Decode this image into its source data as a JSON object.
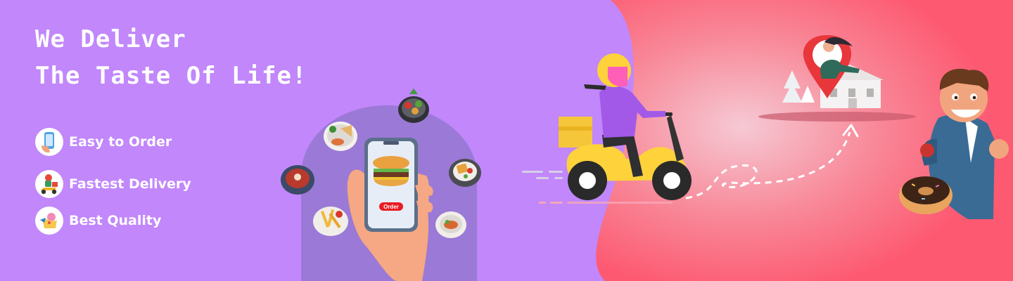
{
  "headline": {
    "line1": "We Deliver",
    "line2": "The Taste Of Life!"
  },
  "features": [
    {
      "label": "Easy to Order",
      "icon": "phone-order-icon"
    },
    {
      "label": "Fastest Delivery",
      "icon": "delivery-scooter-icon"
    },
    {
      "label": "Best Quality",
      "icon": "quality-badge-icon"
    }
  ],
  "phone": {
    "order_button_label": "Order"
  },
  "colors": {
    "purple": "#c187fb",
    "pink": "#fd5b74",
    "yellow": "#fdd23a",
    "red": "#e81c24",
    "white": "#ffffff"
  }
}
